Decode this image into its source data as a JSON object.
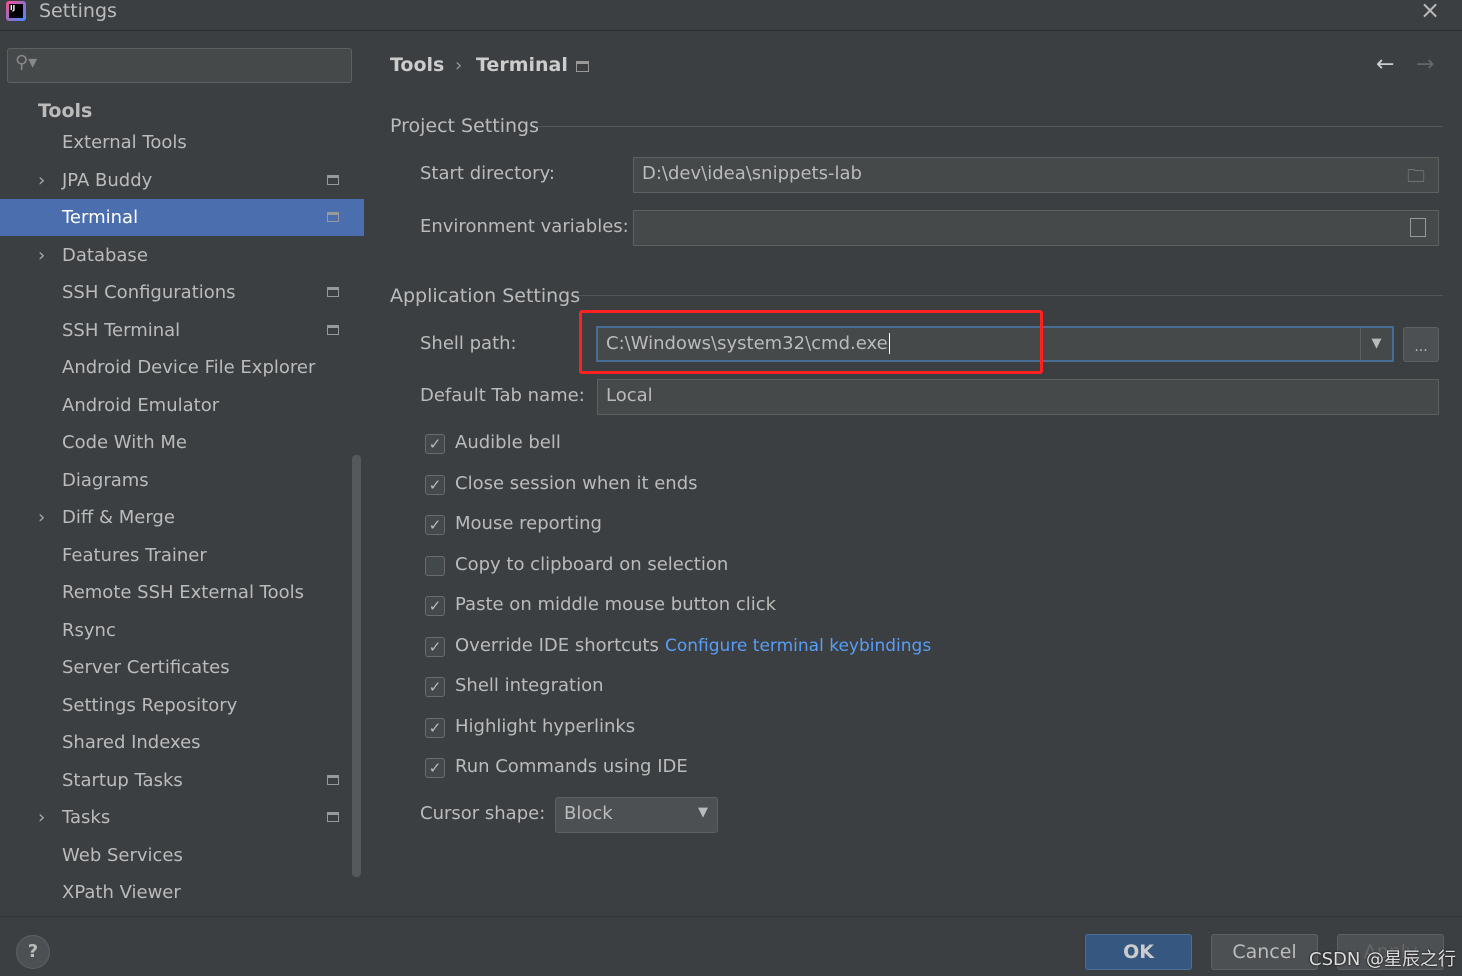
{
  "window": {
    "title": "Settings",
    "close_icon": "close-icon"
  },
  "sidebar": {
    "search_placeholder": "",
    "category": "Tools",
    "items": [
      {
        "label": "External Tools",
        "expandable": false,
        "project_icon": false,
        "selected": false
      },
      {
        "label": "JPA Buddy",
        "expandable": true,
        "project_icon": true,
        "selected": false
      },
      {
        "label": "Terminal",
        "expandable": false,
        "project_icon": true,
        "selected": true
      },
      {
        "label": "Database",
        "expandable": true,
        "project_icon": false,
        "selected": false
      },
      {
        "label": "SSH Configurations",
        "expandable": false,
        "project_icon": true,
        "selected": false
      },
      {
        "label": "SSH Terminal",
        "expandable": false,
        "project_icon": true,
        "selected": false
      },
      {
        "label": "Android Device File Explorer",
        "expandable": false,
        "project_icon": false,
        "selected": false
      },
      {
        "label": "Android Emulator",
        "expandable": false,
        "project_icon": false,
        "selected": false
      },
      {
        "label": "Code With Me",
        "expandable": false,
        "project_icon": false,
        "selected": false
      },
      {
        "label": "Diagrams",
        "expandable": false,
        "project_icon": false,
        "selected": false
      },
      {
        "label": "Diff & Merge",
        "expandable": true,
        "project_icon": false,
        "selected": false
      },
      {
        "label": "Features Trainer",
        "expandable": false,
        "project_icon": false,
        "selected": false
      },
      {
        "label": "Remote SSH External Tools",
        "expandable": false,
        "project_icon": false,
        "selected": false
      },
      {
        "label": "Rsync",
        "expandable": false,
        "project_icon": false,
        "selected": false
      },
      {
        "label": "Server Certificates",
        "expandable": false,
        "project_icon": false,
        "selected": false
      },
      {
        "label": "Settings Repository",
        "expandable": false,
        "project_icon": false,
        "selected": false
      },
      {
        "label": "Shared Indexes",
        "expandable": false,
        "project_icon": false,
        "selected": false
      },
      {
        "label": "Startup Tasks",
        "expandable": false,
        "project_icon": true,
        "selected": false
      },
      {
        "label": "Tasks",
        "expandable": true,
        "project_icon": true,
        "selected": false
      },
      {
        "label": "Web Services",
        "expandable": false,
        "project_icon": false,
        "selected": false
      },
      {
        "label": "XPath Viewer",
        "expandable": false,
        "project_icon": false,
        "selected": false
      }
    ]
  },
  "breadcrumb": {
    "parent": "Tools",
    "separator": "›",
    "current": "Terminal"
  },
  "project_settings": {
    "title": "Project Settings",
    "start_directory_label": "Start directory:",
    "start_directory_value": "D:\\dev\\idea\\snippets-lab",
    "env_label": "Environment variables:",
    "env_value": ""
  },
  "app_settings": {
    "title": "Application Settings",
    "shell_path_label": "Shell path:",
    "shell_path_value": "C:\\Windows\\system32\\cmd.exe",
    "browse_label": "...",
    "tab_name_label": "Default Tab name:",
    "tab_name_value": "Local",
    "checkboxes": [
      {
        "label": "Audible bell",
        "checked": true
      },
      {
        "label": "Close session when it ends",
        "checked": true
      },
      {
        "label": "Mouse reporting",
        "checked": true
      },
      {
        "label": "Copy to clipboard on selection",
        "checked": false
      },
      {
        "label": "Paste on middle mouse button click",
        "checked": true
      },
      {
        "label": "Override IDE shortcuts",
        "checked": true
      },
      {
        "label": "Shell integration",
        "checked": true
      },
      {
        "label": "Highlight hyperlinks",
        "checked": true
      },
      {
        "label": "Run Commands using IDE",
        "checked": true
      }
    ],
    "keybindings_link": "Configure terminal keybindings",
    "cursor_label": "Cursor shape:",
    "cursor_value": "Block"
  },
  "footer": {
    "help": "?",
    "ok": "OK",
    "cancel": "Cancel",
    "apply": "Apply",
    "watermark": "CSDN @星辰之行"
  },
  "colors": {
    "selection": "#4b6eaf",
    "highlight_box": "#ff2020",
    "link": "#589df6",
    "ok_button": "#365880"
  }
}
